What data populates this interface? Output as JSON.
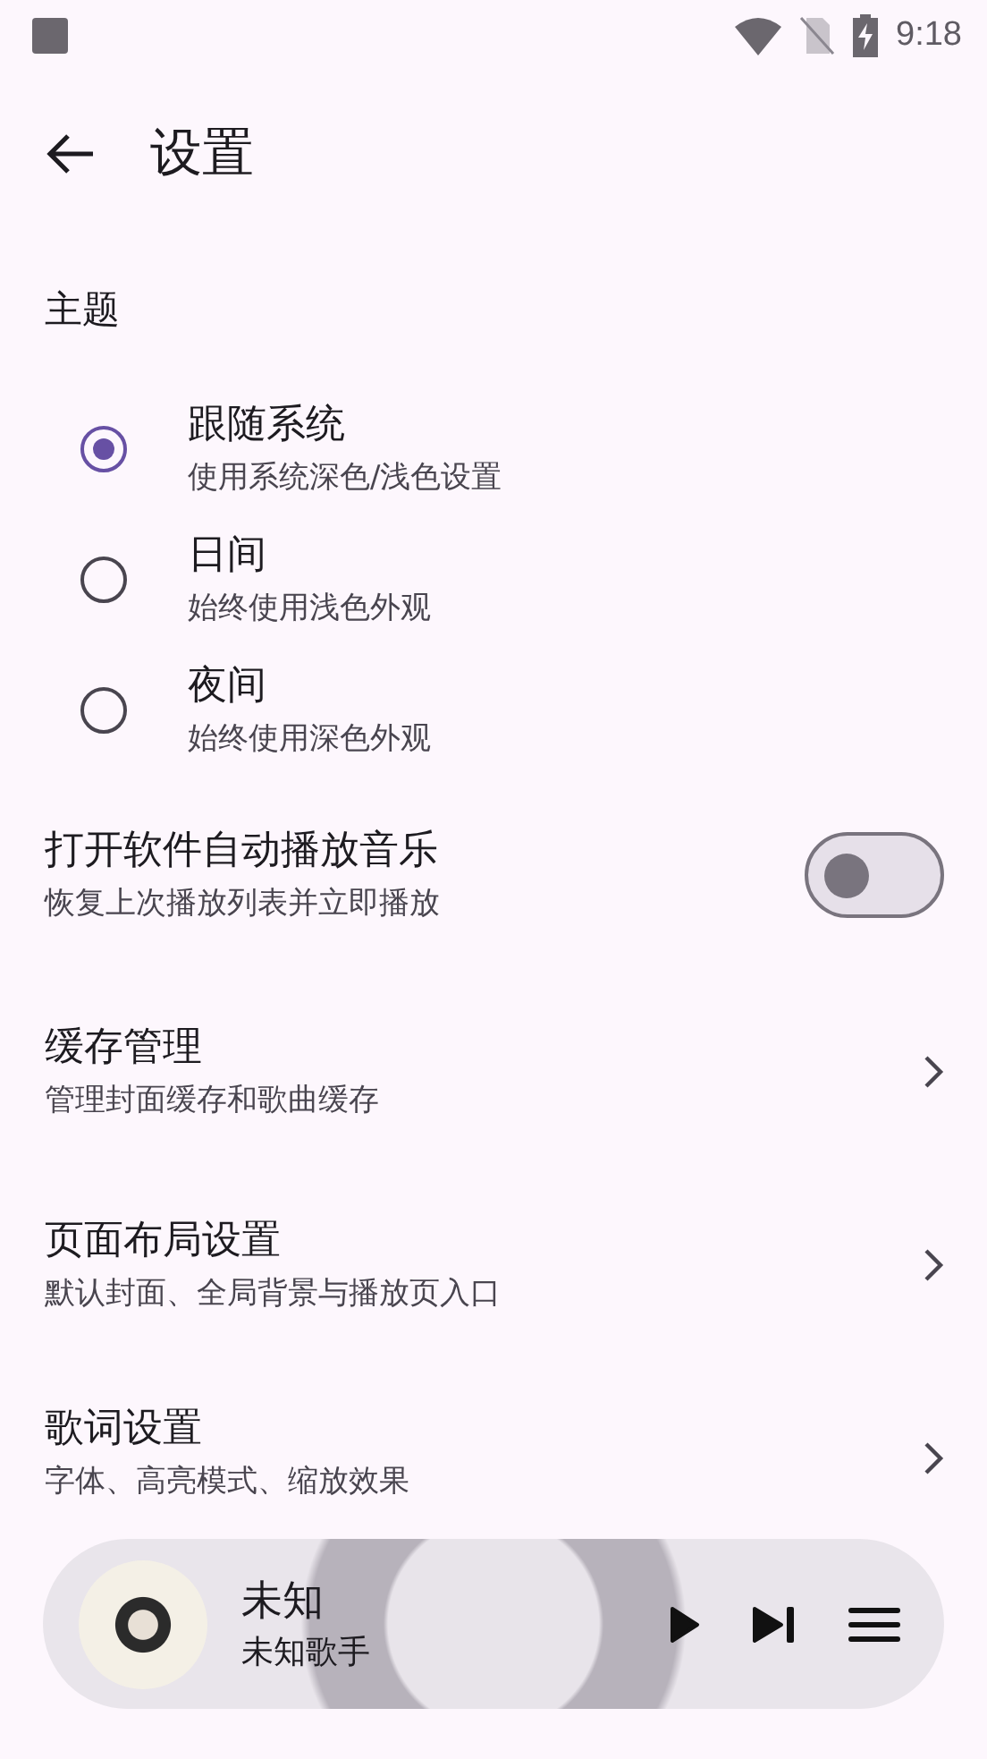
{
  "status_bar": {
    "time": "9:18"
  },
  "app_bar": {
    "title": "设置"
  },
  "theme_section": {
    "header": "主题",
    "options": [
      {
        "title": "跟随系统",
        "subtitle": "使用系统深色/浅色设置",
        "selected": true
      },
      {
        "title": "日间",
        "subtitle": "始终使用浅色外观",
        "selected": false
      },
      {
        "title": "夜间",
        "subtitle": "始终使用深色外观",
        "selected": false
      }
    ]
  },
  "autoplay": {
    "title": "打开软件自动播放音乐",
    "subtitle": "恢复上次播放列表并立即播放",
    "on": false
  },
  "nav_items": [
    {
      "title": "缓存管理",
      "subtitle": "管理封面缓存和歌曲缓存"
    },
    {
      "title": "页面布局设置",
      "subtitle": "默认封面、全局背景与播放页入口"
    },
    {
      "title": "歌词设置",
      "subtitle": "字体、高亮模式、缩放效果"
    }
  ],
  "mini_player": {
    "title": "未知",
    "artist": "未知歌手",
    "playing": false
  }
}
